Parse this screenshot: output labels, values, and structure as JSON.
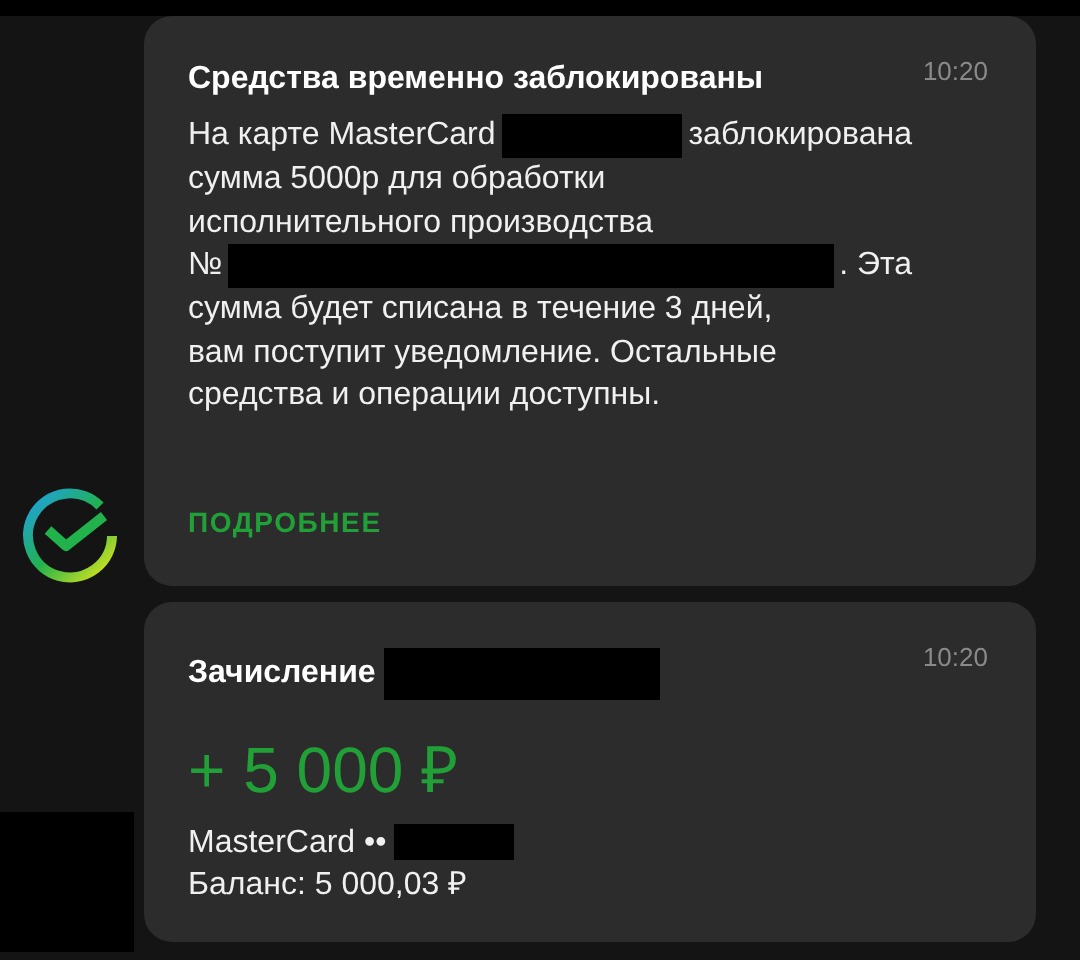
{
  "messages": [
    {
      "title": [
        {
          "kind": "text",
          "text": "Средства временно заблокированы"
        }
      ],
      "time": "10:20",
      "body": [
        [
          {
            "kind": "text",
            "text": "На карте MasterCard"
          },
          {
            "kind": "redacted"
          },
          {
            "kind": "text",
            "text": "заблокирована"
          }
        ],
        [
          {
            "kind": "text",
            "text": "сумма 5000р для обработки"
          }
        ],
        [
          {
            "kind": "text",
            "text": "исполнительного производства"
          }
        ],
        [
          {
            "kind": "text",
            "text": "№"
          },
          {
            "kind": "redacted"
          },
          {
            "kind": "text",
            "text": ". Эта"
          }
        ],
        [
          {
            "kind": "text",
            "text": "сумма будет списана в течение 3 дней,"
          }
        ],
        [
          {
            "kind": "text",
            "text": "вам поступит уведомление. Остальные"
          }
        ],
        [
          {
            "kind": "text",
            "text": "средства и операции доступны."
          }
        ]
      ],
      "link": "ПОДРОБНЕЕ"
    },
    {
      "title": [
        {
          "kind": "text",
          "text": "Зачисление"
        },
        {
          "kind": "redacted"
        }
      ],
      "time": "10:20",
      "amount": "+ 5 000 ₽",
      "details": [
        [
          {
            "kind": "text",
            "text": "MasterCard ••"
          },
          {
            "kind": "redacted"
          }
        ],
        [
          {
            "kind": "text",
            "text": "Баланс: 5 000,03 ₽"
          }
        ]
      ]
    }
  ]
}
